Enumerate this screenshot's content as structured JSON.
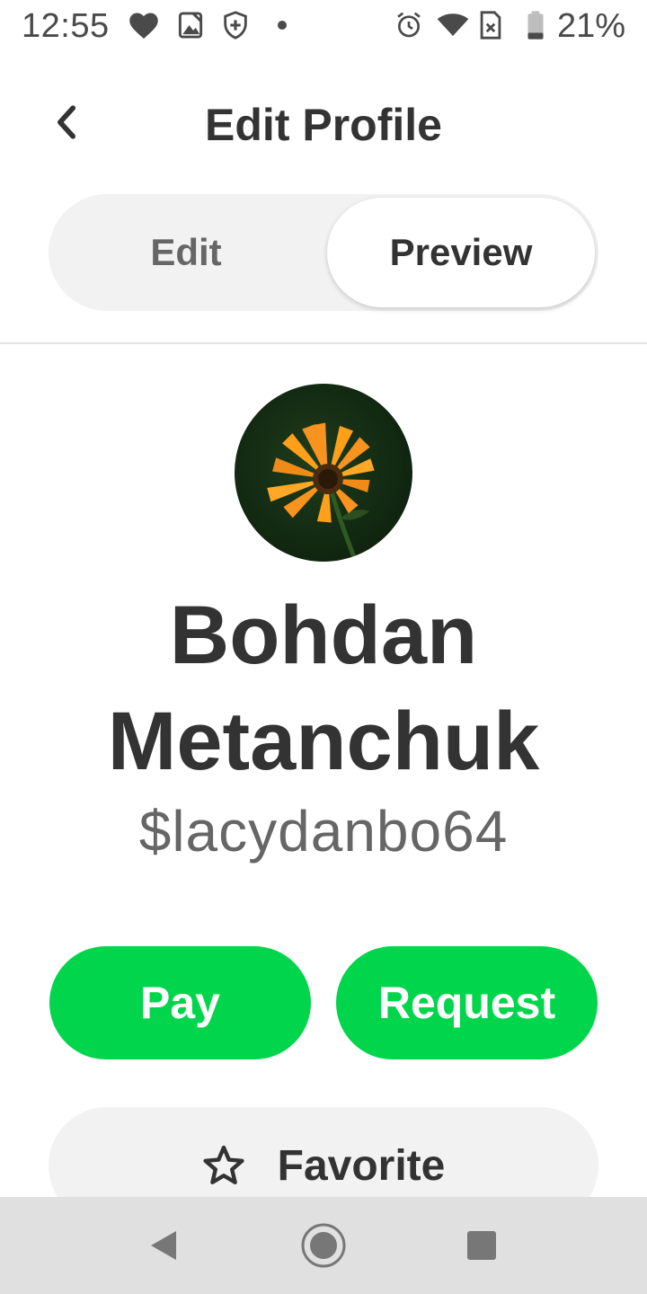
{
  "status_bar": {
    "time": "12:55",
    "battery": "21%",
    "icons": [
      "heart-icon",
      "image-icon",
      "shield-plus-icon",
      "dot-icon",
      "alarm-icon",
      "wifi-icon",
      "sim-icon",
      "battery-icon"
    ]
  },
  "header": {
    "title": "Edit Profile",
    "back_icon": "chevron-left-icon"
  },
  "segmented": {
    "edit_label": "Edit",
    "preview_label": "Preview",
    "selected": "Preview"
  },
  "profile": {
    "avatar": "flower-photo",
    "name": "Bohdan Metanchuk",
    "cashtag": "$lacydanbo64"
  },
  "actions": {
    "pay_label": "Pay",
    "request_label": "Request",
    "favorite_label": "Favorite",
    "favorite_icon": "star-icon"
  },
  "colors": {
    "accent_green": "#00d54b",
    "text_dark": "#333333",
    "text_muted": "#666666",
    "pill_bg": "#f2f2f2",
    "nav_bg": "#e0e0e0"
  },
  "nav_bar": {
    "buttons": [
      "back-triangle-icon",
      "home-circle-icon",
      "recents-square-icon"
    ]
  }
}
